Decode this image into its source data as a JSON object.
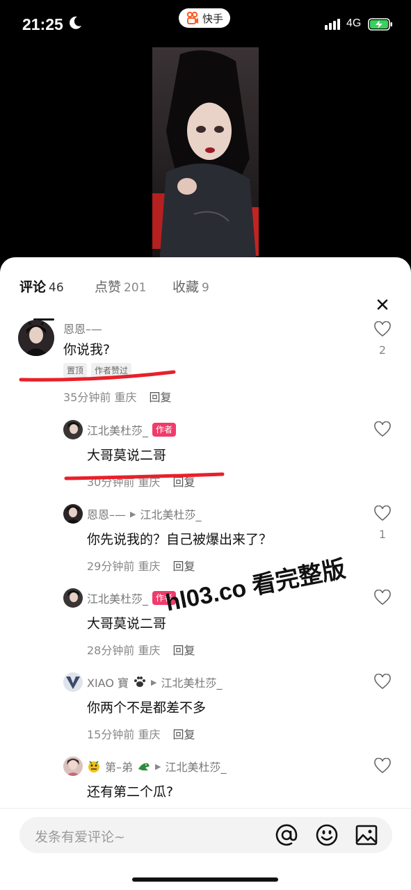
{
  "status_bar": {
    "time": "21:25",
    "network": "4G",
    "app_name": "快手"
  },
  "tabs": [
    {
      "label": "评论",
      "count": "46"
    },
    {
      "label": "点赞",
      "count": "201"
    },
    {
      "label": "收藏",
      "count": "9"
    }
  ],
  "comments": [
    {
      "username": "恩恩–—",
      "text": "你说我?",
      "tags": [
        "置顶",
        "作者赞过"
      ],
      "time": "35分钟前",
      "location": "重庆",
      "reply": "回复",
      "likes": "2"
    },
    {
      "username": "江北美杜莎_",
      "badge": "作者",
      "text": "大哥莫说二哥",
      "time": "30分钟前",
      "location": "重庆",
      "reply": "回复"
    },
    {
      "username": "恩恩–—",
      "reply_to": "江北美杜莎_",
      "text": "你先说我的？自己被爆出来了？",
      "time": "29分钟前",
      "location": "重庆",
      "reply": "回复",
      "likes": "1"
    },
    {
      "username": "江北美杜莎_",
      "badge": "作者",
      "text": "大哥莫说二哥",
      "time": "28分钟前",
      "location": "重庆",
      "reply": "回复"
    },
    {
      "username": "XIAO 寶",
      "reply_to": "江北美杜莎_",
      "text": "你两个不是都差不多",
      "time": "15分钟前",
      "location": "重庆",
      "reply": "回复"
    },
    {
      "username": "第–弟",
      "reply_to": "江北美杜莎_",
      "text": "还有第二个瓜?"
    }
  ],
  "watermark": "hl03.co 看完整版",
  "input": {
    "placeholder": "发条有爱评论~"
  },
  "colors": {
    "author_badge": "#f03c6b",
    "annotation_red": "#e8202a"
  }
}
